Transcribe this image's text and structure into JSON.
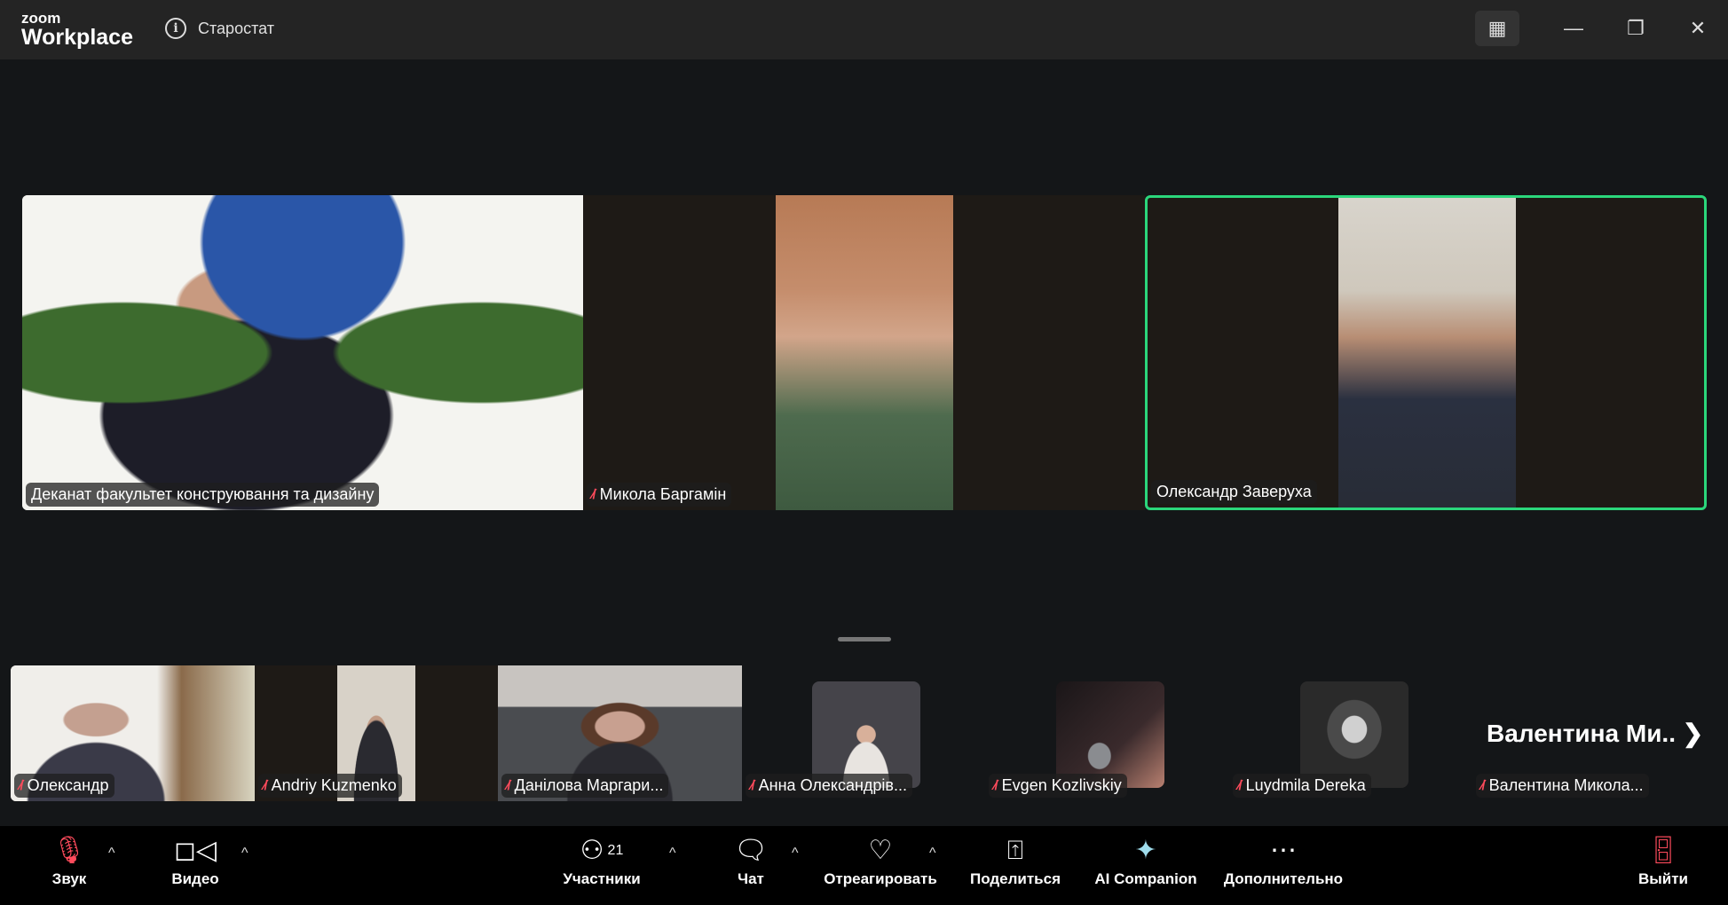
{
  "app": {
    "logo_small": "zoom",
    "logo_big": "Workplace",
    "meeting_title": "Старостат"
  },
  "window": {
    "grid_icon": "grid-icon",
    "minimize": "—",
    "restore": "❐",
    "close": "✕"
  },
  "top_tiles": [
    {
      "name": "Деканат факультет конструювання та дизайну",
      "muted": false,
      "active": false
    },
    {
      "name": "Микола Баргамін",
      "muted": true,
      "active": false
    },
    {
      "name": "Олександр Заверуха",
      "muted": false,
      "active": true
    }
  ],
  "strip_tiles": [
    {
      "name": "Олександр",
      "muted": true
    },
    {
      "name": "Andriy Kuzmenko",
      "muted": true
    },
    {
      "name": "Данілова Маргари...",
      "muted": true
    },
    {
      "name": "Анна Олександрів...",
      "muted": true
    },
    {
      "name": "Evgen Kozlivskiy",
      "muted": true
    },
    {
      "name": "Luydmila Dereka",
      "muted": true
    },
    {
      "name": "Валентина Микола...",
      "muted": true,
      "big_label": "Валентина  Ми.."
    }
  ],
  "colors": {
    "active_speaker": "#2bd67b",
    "muted": "#ff4b5c"
  },
  "toolbar": {
    "audio": "Звук",
    "video": "Видео",
    "participants": "Участники",
    "participants_count": "21",
    "chat": "Чат",
    "react": "Отреагировать",
    "share": "Поделиться",
    "ai": "AI Companion",
    "more": "Дополнительно",
    "leave": "Выйти"
  }
}
